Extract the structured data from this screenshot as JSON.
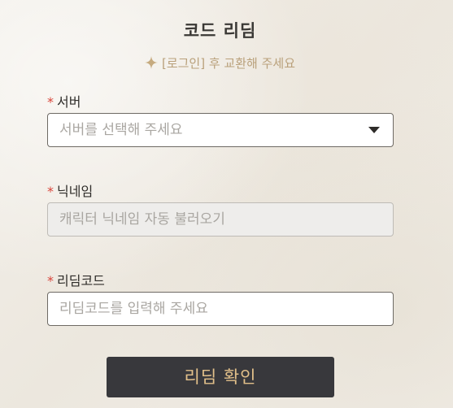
{
  "title": "코드 리딤",
  "subtitle": "[로그인] 후 교환해 주세요",
  "required_mark": "*",
  "colors": {
    "accent_gold": "#e2c08a",
    "subtitle_gold": "#b9a07a",
    "required_red": "#d9443a",
    "button_bg": "#38383c"
  },
  "fields": {
    "server": {
      "label": "서버",
      "placeholder": "서버를 선택해 주세요",
      "icon": "chevron-down-icon"
    },
    "nickname": {
      "label": "닉네임",
      "placeholder": "캐릭터 닉네임 자동 불러오기"
    },
    "code": {
      "label": "리딤코드",
      "placeholder": "리딤코드를 입력해 주세요"
    }
  },
  "submit_label": "리딤 확인"
}
